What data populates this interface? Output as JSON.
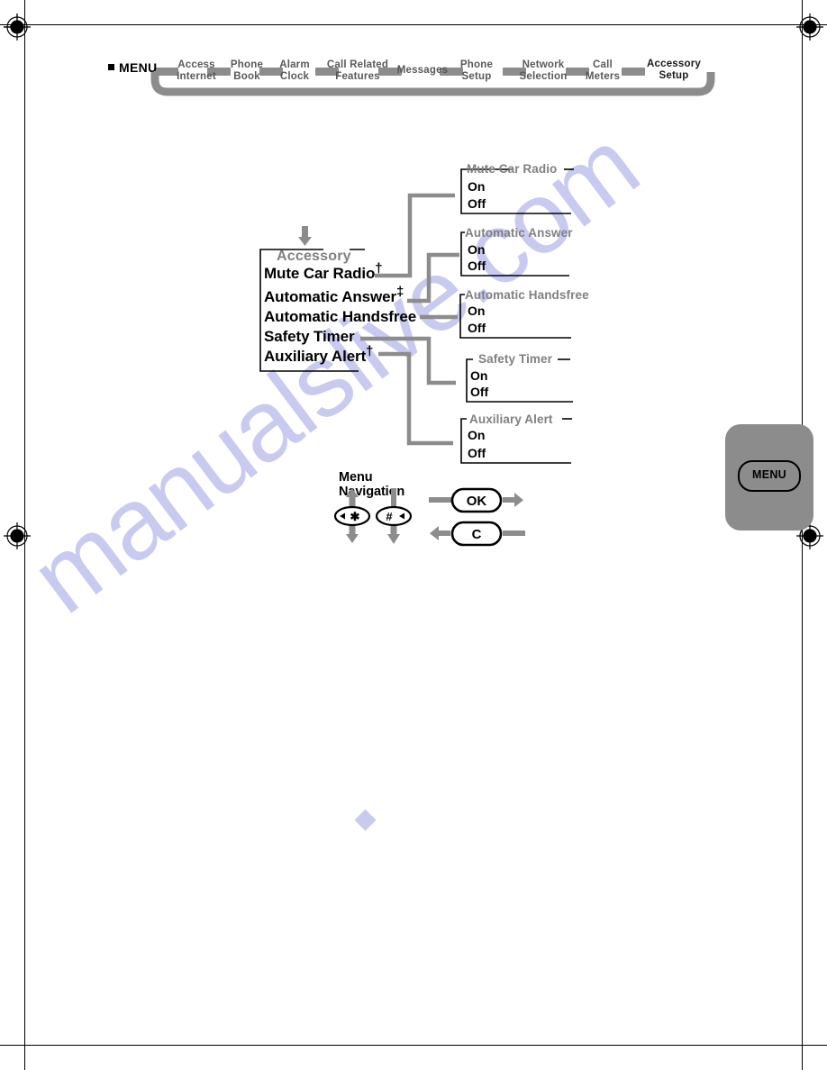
{
  "breadcrumb": {
    "root_label": "MENU",
    "items": [
      {
        "line1": "Access",
        "line2": "Internet",
        "active": false
      },
      {
        "line1": "Phone",
        "line2": "Book",
        "active": false
      },
      {
        "line1": "Alarm",
        "line2": "Clock",
        "active": false
      },
      {
        "line1": "Call Related",
        "line2": "Features",
        "active": false
      },
      {
        "line1": "Messages",
        "line2": "",
        "active": false
      },
      {
        "line1": "Phone",
        "line2": "Setup",
        "active": false
      },
      {
        "line1": "Network",
        "line2": "Selection",
        "active": false
      },
      {
        "line1": "Call",
        "line2": "Meters",
        "active": false
      },
      {
        "line1": "Accessory",
        "line2": "Setup",
        "active": true
      }
    ]
  },
  "tree": {
    "parent": {
      "title": "Accessory",
      "items": [
        {
          "label": "Mute Car Radio",
          "marker": "†"
        },
        {
          "label": "Automatic Answer",
          "marker": "‡"
        },
        {
          "label": "Automatic Handsfree",
          "marker": ""
        },
        {
          "label": "Safety Timer",
          "marker": ""
        },
        {
          "label": "Auxiliary Alert",
          "marker": "†"
        }
      ]
    },
    "submenus": [
      {
        "title": "Mute Car Radio",
        "options": [
          "On",
          "Off"
        ]
      },
      {
        "title": "Automatic Answer",
        "options": [
          "On",
          "Off"
        ]
      },
      {
        "title": "Automatic Handsfree",
        "options": [
          "On",
          "Off"
        ]
      },
      {
        "title": "Safety Timer",
        "options": [
          "On",
          "Off"
        ]
      },
      {
        "title": "Auxiliary Alert",
        "options": [
          "On",
          "Off"
        ]
      }
    ]
  },
  "navigation": {
    "title": "Menu Navigation",
    "keys": {
      "star_key": "✴",
      "hash_key": "#",
      "ok_key": "OK",
      "clear_key": "C"
    }
  },
  "side_tab": {
    "label": "MENU"
  },
  "watermark": {
    "text": "manualslive.com"
  },
  "colors": {
    "gray_connector": "#808080",
    "gray_title": "#808080",
    "menu_bar": "#8c8c8c",
    "black": "#000000",
    "watermark": "#c9caf0"
  }
}
